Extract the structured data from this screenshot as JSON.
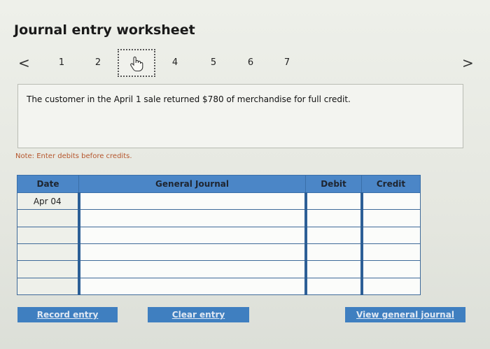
{
  "title": "Journal entry worksheet",
  "nav": {
    "prev_icon": "chevron-left-icon",
    "next_icon": "chevron-right-icon",
    "prev_glyph": "<",
    "next_glyph": ">",
    "pages": [
      "1",
      "2",
      "3",
      "4",
      "5",
      "6",
      "7"
    ],
    "current_page": "3",
    "current_icon": "hand-pointer-icon"
  },
  "prompt": "The customer in the April 1 sale returned $780 of merchandise for full credit.",
  "note": "Note: Enter debits before credits.",
  "table": {
    "headers": {
      "date": "Date",
      "general_journal": "General Journal",
      "debit": "Debit",
      "credit": "Credit"
    },
    "rows": [
      {
        "date": "Apr 04",
        "account": "",
        "debit": "",
        "credit": ""
      },
      {
        "date": "",
        "account": "",
        "debit": "",
        "credit": ""
      },
      {
        "date": "",
        "account": "",
        "debit": "",
        "credit": ""
      },
      {
        "date": "",
        "account": "",
        "debit": "",
        "credit": ""
      },
      {
        "date": "",
        "account": "",
        "debit": "",
        "credit": ""
      },
      {
        "date": "",
        "account": "",
        "debit": "",
        "credit": ""
      }
    ]
  },
  "buttons": {
    "record": "Record entry",
    "clear": "Clear entry",
    "view": "View general journal"
  },
  "colors": {
    "accent": "#4b86c7",
    "note": "#b5552c",
    "button": "#3f7fc0"
  }
}
